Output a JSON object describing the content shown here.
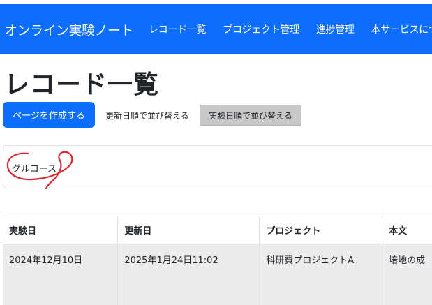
{
  "navbar": {
    "brand": "オンライン実験ノート",
    "links": [
      "レコード一覧",
      "プロジェクト管理",
      "進捗管理",
      "本サービスについて"
    ],
    "color": "#0d6efd"
  },
  "page": {
    "title": "レコード一覧"
  },
  "toolbar": {
    "create_label": "ページを作成する",
    "sort_updated_label": "更新日順で並び替える",
    "sort_experiment_label": "実験日順で並び替える"
  },
  "search_card": {
    "text": "グルコース",
    "annotation_color": "#d9282f"
  },
  "table": {
    "headers": [
      "実験日",
      "更新日",
      "プロジェクト",
      "本文"
    ],
    "rows": [
      [
        "2024年12月10日",
        "2025年1月24日11:02",
        "科研費プロジェクトA",
        "培地の成"
      ]
    ]
  }
}
